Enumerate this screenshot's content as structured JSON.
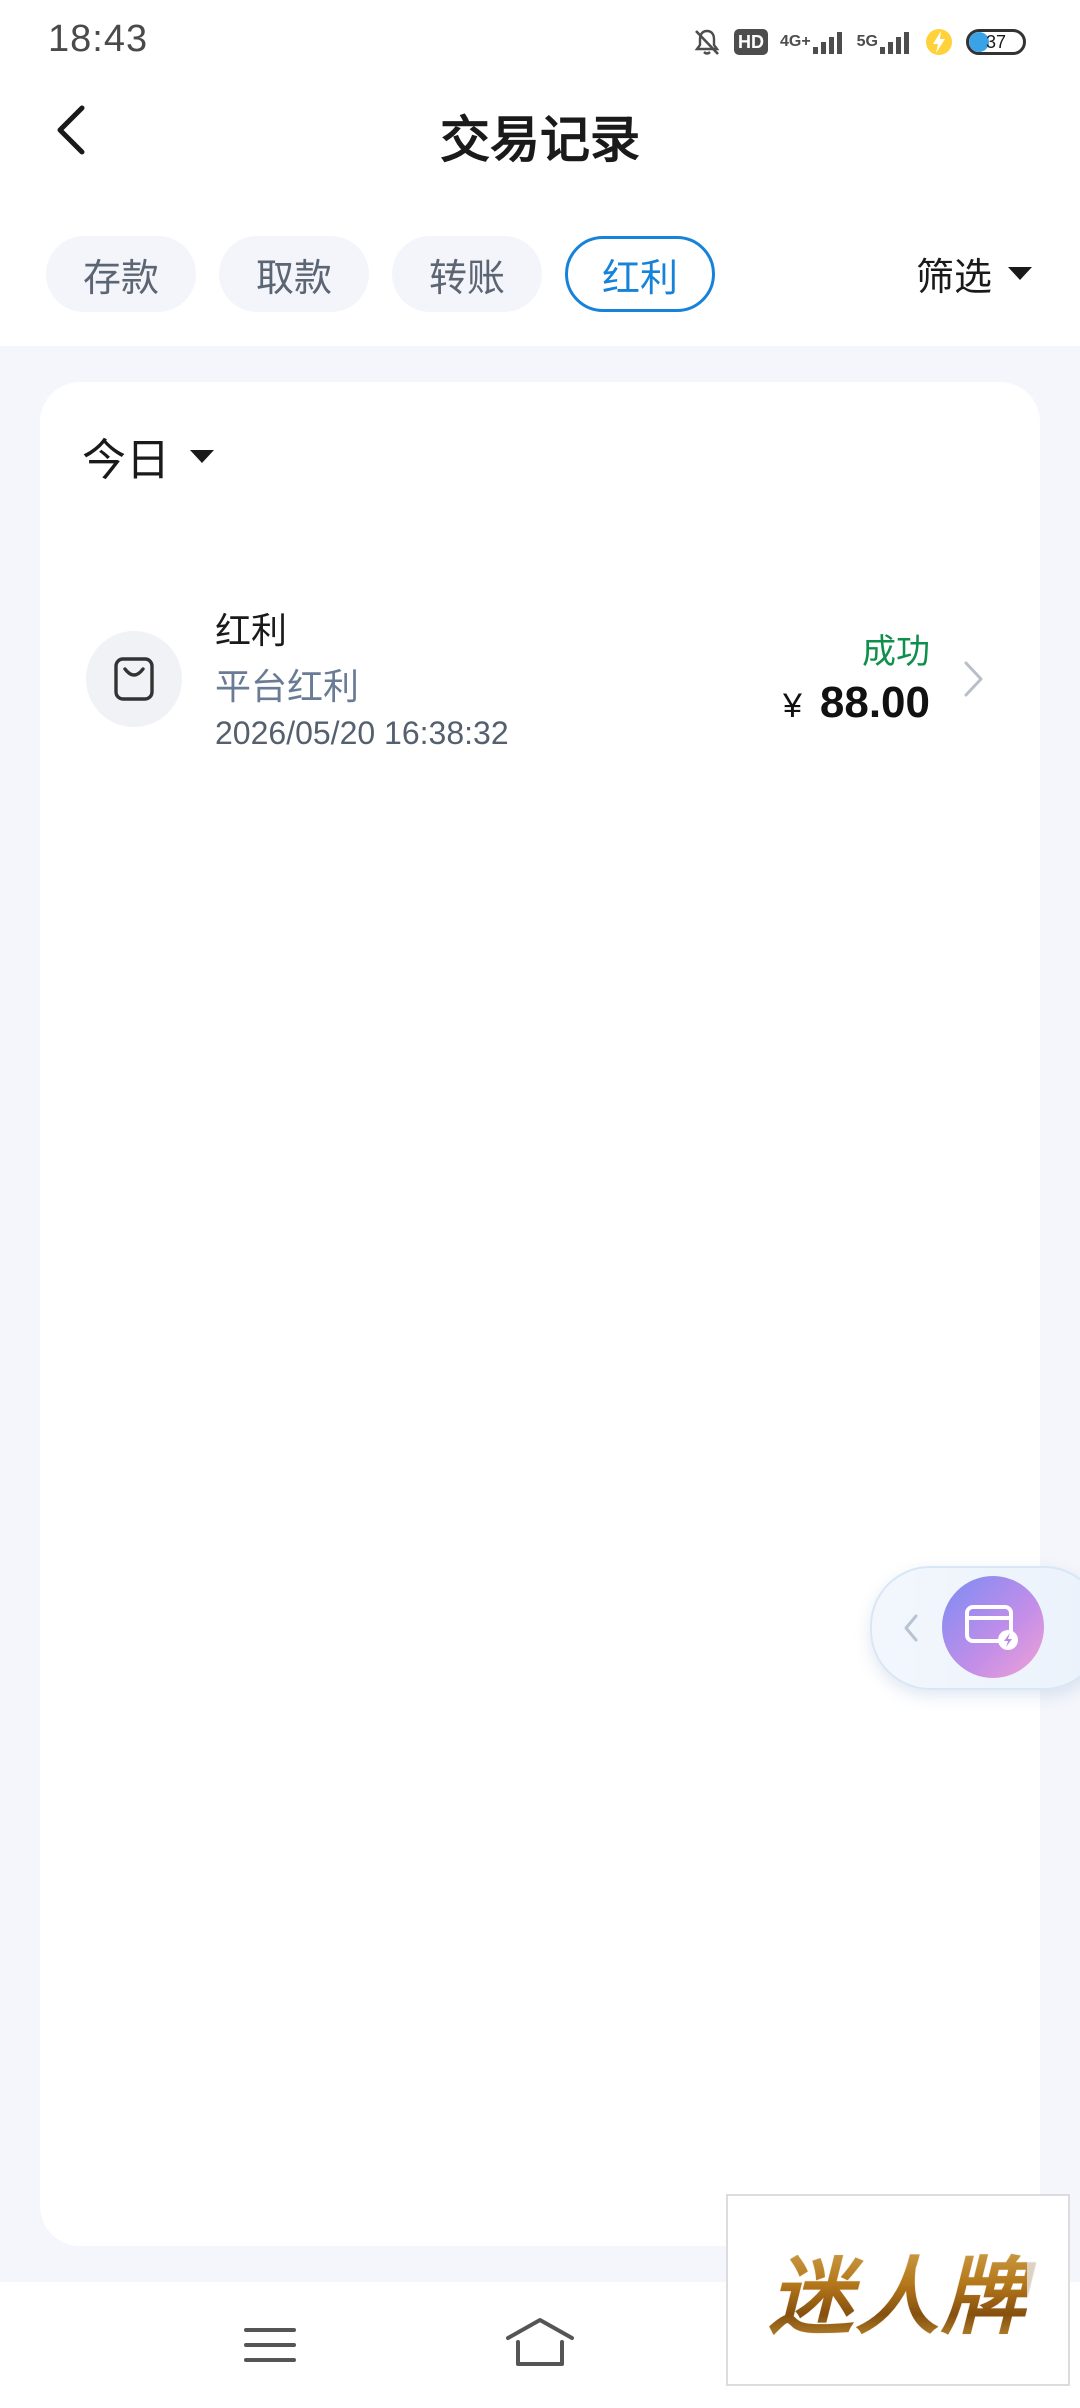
{
  "status_bar": {
    "time": "18:43",
    "hd_label": "HD",
    "network_1": "4G+",
    "network_2": "5G",
    "battery_level": "37",
    "battery_fraction": 0.37
  },
  "header": {
    "title": "交易记录",
    "back_icon": "chevron-left-icon"
  },
  "tabs": [
    {
      "label": "存款",
      "active": false
    },
    {
      "label": "取款",
      "active": false
    },
    {
      "label": "转账",
      "active": false
    },
    {
      "label": "红利",
      "active": true
    }
  ],
  "filter": {
    "label": "筛选",
    "icon": "caret-down-icon"
  },
  "date_filter": {
    "label": "今日",
    "icon": "caret-down-icon"
  },
  "records": [
    {
      "title": "红利",
      "subtitle": "平台红利",
      "time": "2026/05/20 16:38:32",
      "status": "成功",
      "currency": "¥",
      "amount": "88.00",
      "icon": "bag-icon"
    }
  ],
  "float_widget": {
    "icon": "card-lightning-icon"
  },
  "nav_bar": {
    "menu_icon": "menu-icon",
    "home_icon": "home-icon"
  },
  "watermark": {
    "text": "迷人牌"
  },
  "colors": {
    "accent": "#1682d9",
    "success": "#0e8f4c",
    "background": "#f4f6fb"
  }
}
